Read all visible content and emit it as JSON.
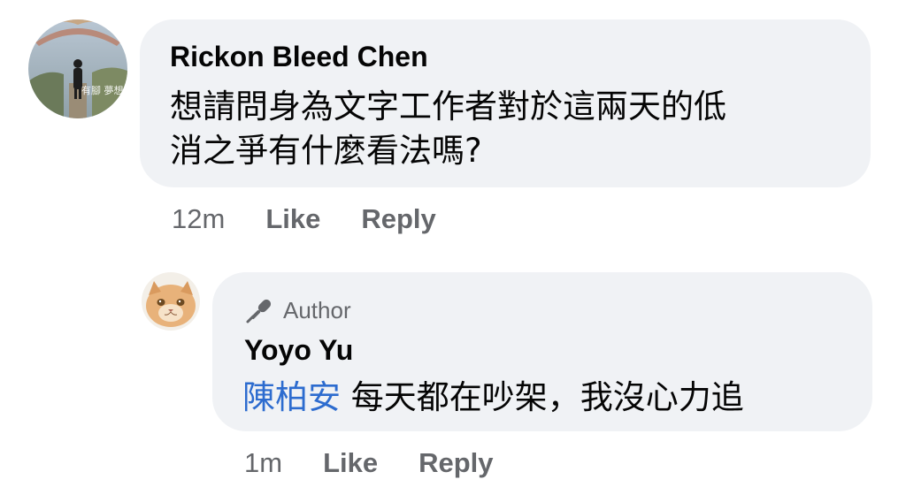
{
  "comments": [
    {
      "author": "Rickon Bleed Chen",
      "avatar_caption": "有腳  夢想",
      "text_line1": "想請問身為文字工作者對於這兩天的低",
      "text_line2": "消之爭有什麼看法嗎?",
      "time": "12m",
      "like_label": "Like",
      "reply_label": "Reply"
    }
  ],
  "reply": {
    "badge_icon": "microphone-icon",
    "badge_label": "Author",
    "author": "Yoyo Yu",
    "mention": "陳柏安",
    "text": " 每天都在吵架，我沒心力追",
    "time": "1m",
    "like_label": "Like",
    "reply_label": "Reply"
  },
  "colors": {
    "bubble": "#f0f2f5",
    "text": "#050505",
    "secondary": "#65676b",
    "mention": "#2d6ccf"
  }
}
